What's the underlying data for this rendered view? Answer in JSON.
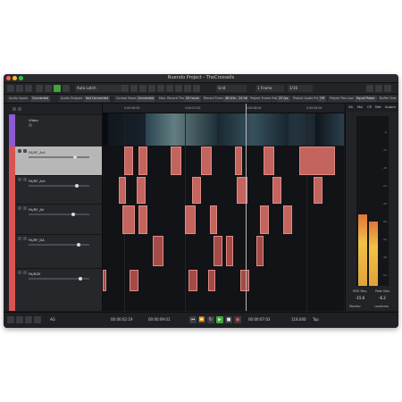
{
  "window": {
    "title": "Nuendo Project - TheCrossells"
  },
  "toolbar": {
    "automation_mode": "Auto Latch",
    "grid_label": "Grid",
    "frame_label": "1 Frame",
    "quantize_label": "1/16"
  },
  "infobar": {
    "items": [
      {
        "label": "Audio Inputs",
        "value": "Connected"
      },
      {
        "label": "Audio Outputs",
        "value": "Not Connected"
      },
      {
        "label": "Control Room",
        "value": "Connected"
      },
      {
        "label": "Max. Record Time",
        "value": "59 hours"
      },
      {
        "label": "Record Format",
        "value": "48 kHz - 24 bit"
      },
      {
        "label": "Project Frame Rate",
        "value": "25 fps"
      },
      {
        "label": "Project Audio Pull",
        "value": "Off"
      },
      {
        "label": "Project Pan Law",
        "value": "Equal Power"
      },
      {
        "label": "Buffer Size",
        "value": ""
      }
    ]
  },
  "timeline": {
    "status": "No Object Selected",
    "ruler_ticks": [
      "0:00:06:00",
      "0:00:07:00",
      "0:00:08:00",
      "0:00:09:00"
    ]
  },
  "tracks": [
    {
      "name": "Video",
      "color": "#8d5ad1"
    },
    {
      "name": "FA/RF_Act",
      "color": "#d9534f"
    },
    {
      "name": "FA/RF_Act",
      "color": "#d9534f"
    },
    {
      "name": "FA/RF_AV",
      "color": "#d9534f"
    },
    {
      "name": "FA/RF_DA",
      "color": "#d9534f"
    },
    {
      "name": "FA/RZE",
      "color": "#d9534f"
    }
  ],
  "right_panel": {
    "tabs": [
      "VIL",
      "Mix",
      "CR",
      "Met",
      "Autom"
    ],
    "rms_max_label": "RMS Max.",
    "peak_max_label": "Peak Max.",
    "rms_max": "-15.6",
    "peak_max": "-6.2",
    "left_meter_level": 0.42,
    "right_meter_level": 0.38,
    "scale": [
      "-6",
      "-12",
      "-18",
      "-24",
      "-30",
      "-36",
      "-42",
      "-48",
      "-54"
    ],
    "footer_left": "Monitor",
    "footer_right": "Loudness"
  },
  "transport": {
    "left_locator": "00:00:02:19",
    "right_locator": "00:00:09:01",
    "position": "00:00:07:03",
    "tempo": "118.000",
    "tap_label": "Tap",
    "mode_label": "AG"
  },
  "colors": {
    "event_fill": "#c4645f",
    "event_border": "#e08a84",
    "play_green": "#3da63b",
    "meter_amber": "#f0c247"
  }
}
